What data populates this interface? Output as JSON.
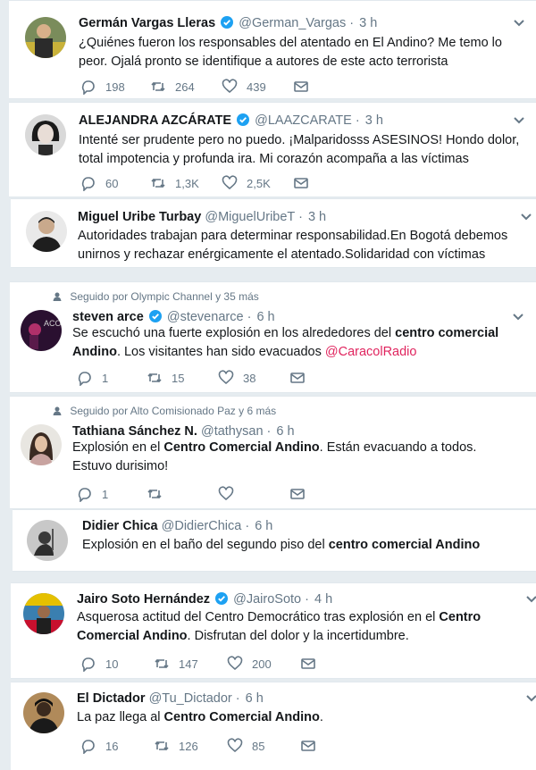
{
  "tweets": [
    {
      "name": "Germán Vargas Lleras",
      "handle": "@German_Vargas",
      "time": "3 h",
      "text": "¿Quiénes fueron los responsables del atentado en El Andino? Me temo lo peor. Ojalá pronto se identifique a autores de este acto terrorista",
      "replies": "198",
      "retweets": "264",
      "likes": "439"
    },
    {
      "name": "ALEJANDRA AZCÁRATE",
      "handle": "@LAAZCARATE",
      "time": "3 h",
      "text": "Intenté ser prudente pero no puedo. ¡Malparidosss ASESINOS! Hondo dolor, total impotencia y profunda ira. Mi corazón acompaña a las víctimas",
      "replies": "60",
      "retweets": "1,3K",
      "likes": "2,5K"
    },
    {
      "name": "Miguel Uribe Turbay",
      "handle": "@MiguelUribeT",
      "time": "3 h",
      "text": "Autoridades trabajan para determinar responsabilidad.En Bogotá debemos unirnos y rechazar enérgicamente el atentado.Solidaridad con víctimas"
    },
    {
      "context": "Seguido por Olympic Channel y 35 más",
      "name": "steven arce",
      "handle": "@stevenarce",
      "time": "6 h",
      "text_pre": "Se escuchó una fuerte explosión en los alrededores del ",
      "text_bold": "centro comercial Andino",
      "text_post": ". Los visitantes han sido evacuados ",
      "mention": "@CaracolRadio",
      "replies": "1",
      "retweets": "15",
      "likes": "38"
    },
    {
      "context": "Seguido por Alto Comisionado Paz y 6 más",
      "name": "Tathiana Sánchez N.",
      "handle": "@tathysan",
      "time": "6 h",
      "text_pre": "Explosión en el ",
      "text_bold": "Centro Comercial Andino",
      "text_post": ". Están evacuando a todos. Estuvo durisimo!",
      "replies": "1"
    },
    {
      "name": "Didier Chica",
      "handle": "@DidierChica",
      "time": "6 h",
      "text_pre": "Explosión en el baño del segundo piso del ",
      "text_bold": "centro comercial Andino"
    },
    {
      "name": "Jairo Soto Hernández",
      "handle": "@JairoSoto",
      "time": "4 h",
      "text_pre": "Asquerosa actitud del Centro Democrático tras explosión en el ",
      "text_bold": "Centro Comercial Andino",
      "text_post": ". Disfrutan del dolor y la incertidumbre.",
      "replies": "10",
      "retweets": "147",
      "likes": "200"
    },
    {
      "name": "El Dictador",
      "handle": "@Tu_Dictador",
      "time": "6 h",
      "text_pre": "La paz llega al ",
      "text_bold": "Centro Comercial Andino",
      "text_post": ".",
      "replies": "16",
      "retweets": "126",
      "likes": "85"
    }
  ],
  "icons": {
    "reply": "reply-icon",
    "retweet": "retweet-icon",
    "like": "heart-icon",
    "dm": "envelope-icon",
    "caret": "chevron-down-icon",
    "verified": "verified-badge-icon",
    "context": "person-icon"
  },
  "colors": {
    "verified": "#1da1f2",
    "mention": "#e0245e",
    "secondary": "#657786"
  }
}
